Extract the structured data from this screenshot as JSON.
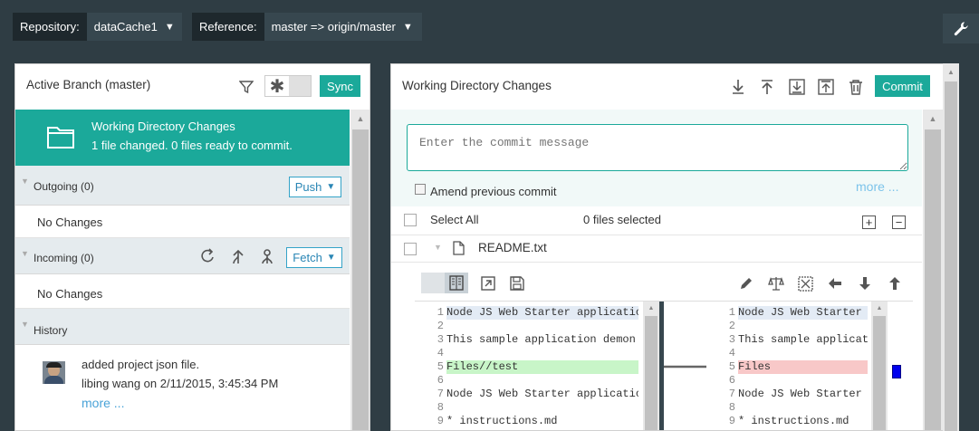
{
  "topbar": {
    "repo_label": "Repository:",
    "repo_value": "dataCache1",
    "ref_label": "Reference:",
    "ref_value": "master => origin/master",
    "caret": "▼",
    "settings_icon": "wrench-icon"
  },
  "left": {
    "title": "Active Branch (master)",
    "sync_label": "Sync",
    "wdc_title": "Working Directory Changes",
    "wdc_subtitle": "1 file changed. 0 files ready to commit.",
    "outgoing_label": "Outgoing (0)",
    "push_label": "Push",
    "outgoing_empty": "No Changes",
    "incoming_label": "Incoming (0)",
    "fetch_label": "Fetch",
    "incoming_empty": "No Changes",
    "history_label": "History",
    "commit_message": "added project json file.",
    "commit_meta": "libing wang on 2/11/2015, 3:45:34 PM",
    "more_label": "more ..."
  },
  "right": {
    "title": "Working Directory Changes",
    "commit_label": "Commit",
    "message_placeholder": "Enter the commit message",
    "amend_label": "Amend previous commit",
    "more_label": "more ...",
    "select_all_label": "Select All",
    "files_selected": "0 files selected",
    "file_name": "README.txt"
  },
  "diff": {
    "left_lines": [
      {
        "n": "1",
        "text": "Node JS Web Starter applicatio",
        "type": "context"
      },
      {
        "n": "2",
        "text": "",
        "type": "normal"
      },
      {
        "n": "3",
        "text": "This sample application demon",
        "type": "normal"
      },
      {
        "n": "4",
        "text": "",
        "type": "normal"
      },
      {
        "n": "5",
        "text": "Files//test",
        "type": "added"
      },
      {
        "n": "6",
        "text": "",
        "type": "normal"
      },
      {
        "n": "7",
        "text": "Node JS Web Starter applicatio",
        "type": "normal"
      },
      {
        "n": "8",
        "text": "",
        "type": "normal"
      },
      {
        "n": "9",
        "text": "*   instructions.md",
        "type": "normal"
      }
    ],
    "right_lines": [
      {
        "n": "1",
        "text": "Node JS Web Starter",
        "type": "context"
      },
      {
        "n": "2",
        "text": "",
        "type": "normal"
      },
      {
        "n": "3",
        "text": "This sample applicat",
        "type": "normal"
      },
      {
        "n": "4",
        "text": "",
        "type": "normal"
      },
      {
        "n": "5",
        "text": "Files",
        "type": "removed"
      },
      {
        "n": "6",
        "text": "",
        "type": "normal"
      },
      {
        "n": "7",
        "text": "Node JS Web Starter",
        "type": "normal"
      },
      {
        "n": "8",
        "text": "",
        "type": "normal"
      },
      {
        "n": "9",
        "text": "*   instructions.md",
        "type": "normal"
      }
    ]
  },
  "colors": {
    "accent": "#1ba99a",
    "link": "#2a86b5",
    "added_bg": "#c8f5c8",
    "removed_bg": "#f8c8c8",
    "context_bg": "#e3ebf5"
  }
}
